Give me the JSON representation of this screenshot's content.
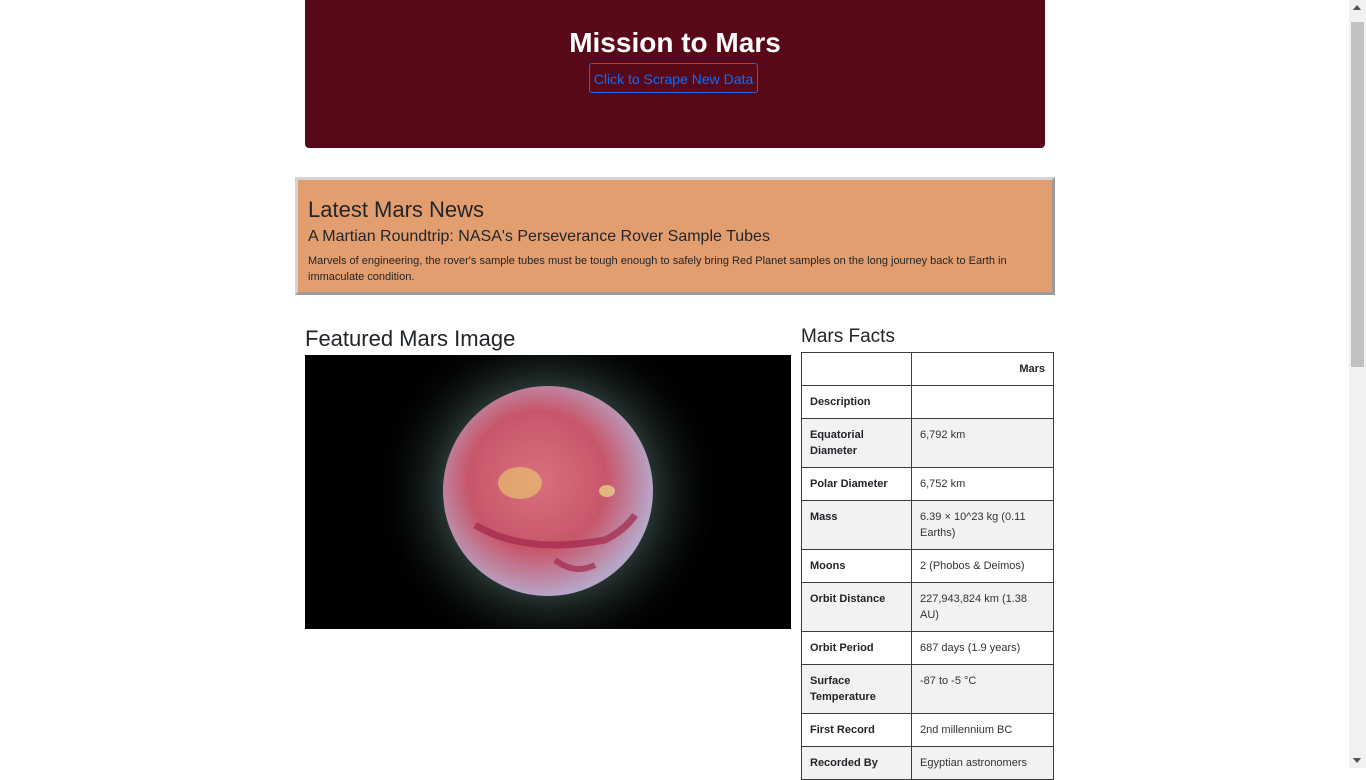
{
  "header": {
    "title": "Mission to Mars",
    "scrape_button_label": "Click to Scrape New Data"
  },
  "news": {
    "heading": "Latest Mars News",
    "title": "A Martian Roundtrip: NASA's Perseverance Rover Sample Tubes",
    "paragraph": "Marvels of engineering, the rover's sample tubes must be tough enough to safely bring Red Planet samples on the long journey back to Earth in immaculate condition."
  },
  "featured_image": {
    "heading": "Featured Mars Image"
  },
  "facts": {
    "heading": "Mars Facts",
    "column_header": "Mars",
    "rows": [
      {
        "label": "Description",
        "value": ""
      },
      {
        "label": "Equatorial Diameter",
        "value": "6,792 km"
      },
      {
        "label": "Polar Diameter",
        "value": "6,752 km"
      },
      {
        "label": "Mass",
        "value": "6.39 × 10^23 kg (0.11 Earths)"
      },
      {
        "label": "Moons",
        "value": "2 (Phobos & Deimos)"
      },
      {
        "label": "Orbit Distance",
        "value": "227,943,824 km (1.38 AU)"
      },
      {
        "label": "Orbit Period",
        "value": "687 days (1.9 years)"
      },
      {
        "label": "Surface Temperature",
        "value": "-87 to -5 °C"
      },
      {
        "label": "First Record",
        "value": "2nd millennium BC"
      },
      {
        "label": "Recorded By",
        "value": "Egyptian astronomers"
      }
    ]
  },
  "colors": {
    "header_bg": "#590818",
    "news_bg": "#e39e70",
    "button_accent": "#0d6efd"
  }
}
